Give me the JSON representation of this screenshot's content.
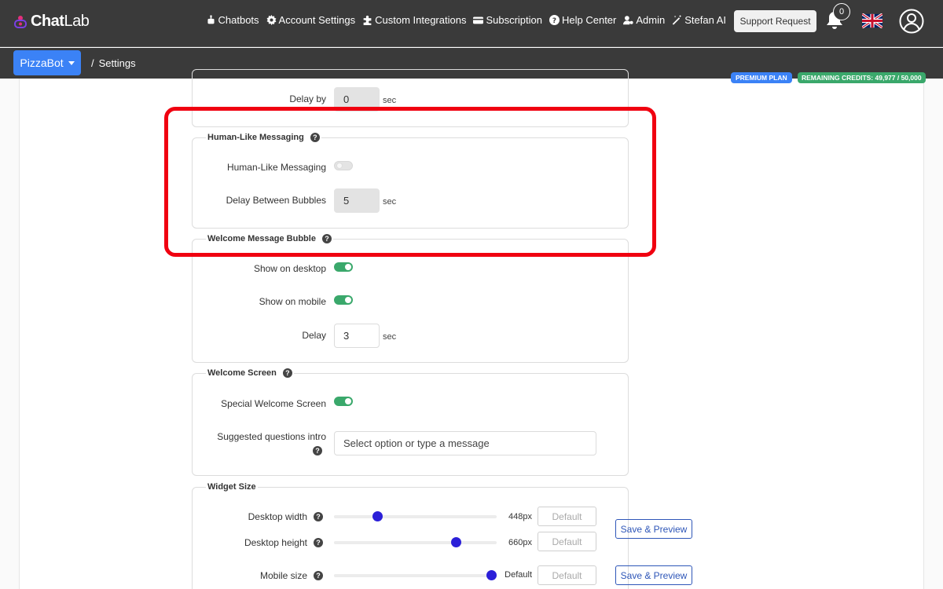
{
  "app": {
    "logo_chat": "Chat",
    "logo_lab": "Lab"
  },
  "nav": [
    {
      "label": "Chatbots",
      "icon": "robot-icon"
    },
    {
      "label": "Account Settings",
      "icon": "gear-icon"
    },
    {
      "label": "Custom Integrations",
      "icon": "puzzle-icon"
    },
    {
      "label": "Subscription",
      "icon": "credit-card-icon"
    },
    {
      "label": "Help Center",
      "icon": "question-circle-icon"
    },
    {
      "label": "Admin",
      "icon": "user-cog-icon"
    },
    {
      "label": "Stefan AI",
      "icon": "magic-wand-icon"
    }
  ],
  "header": {
    "support_label": "Support Request",
    "notification_count": "0"
  },
  "subbar": {
    "bot_name": "PizzaBot",
    "breadcrumb_sep": "/",
    "breadcrumb": "Settings"
  },
  "badges": {
    "plan": "PREMIUM PLAN",
    "credits": "REMAINING CREDITS: 49,977 / 50,000"
  },
  "delay_section": {
    "label": "Delay by",
    "value": "0",
    "unit": "sec"
  },
  "human_like": {
    "legend": "Human-Like Messaging",
    "toggle_label": "Human-Like Messaging",
    "toggle_on": false,
    "bubbles_label": "Delay Between Bubbles",
    "bubbles_value": "5",
    "unit": "sec"
  },
  "welcome_bubble": {
    "legend": "Welcome Message Bubble",
    "desktop_label": "Show on desktop",
    "desktop_on": true,
    "mobile_label": "Show on mobile",
    "mobile_on": true,
    "delay_label": "Delay",
    "delay_value": "3",
    "unit": "sec"
  },
  "welcome_screen": {
    "legend": "Welcome Screen",
    "special_label": "Special Welcome Screen",
    "special_on": true,
    "intro_label": "Suggested questions intro",
    "intro_placeholder": "Select option or type a message"
  },
  "widget_size": {
    "legend": "Widget Size",
    "desktop_width_label": "Desktop width",
    "desktop_width_value": "448px",
    "desktop_width_level": 0.27,
    "desktop_height_label": "Desktop height",
    "desktop_height_value": "660px",
    "desktop_height_level": 0.75,
    "mobile_size_label": "Mobile size",
    "mobile_size_value": "Default",
    "mobile_size_level": 0.97,
    "default_label": "Default",
    "save_label": "Save & Preview"
  },
  "help_glyph": "?",
  "colors": {
    "accent": "#3b82f6",
    "toggle_on": "#3aa86b",
    "slider_thumb": "#2b1fd8",
    "highlight": "#f00010"
  }
}
